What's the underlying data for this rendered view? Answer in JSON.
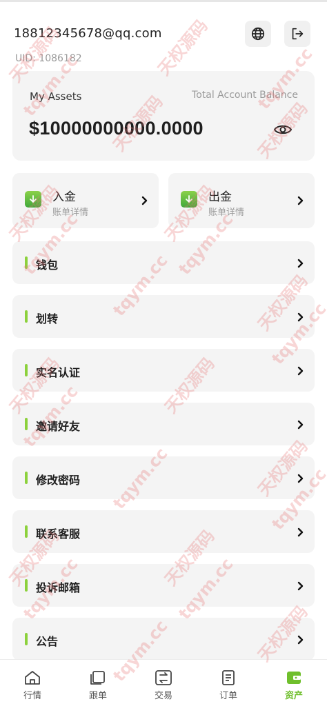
{
  "header": {
    "email": "18812345678@qq.com",
    "uid": "UID: 1086182"
  },
  "assets": {
    "title": "My Assets",
    "subtitle": "Total Account Balance",
    "amount": "$10000000000.0000"
  },
  "actions": {
    "deposit": {
      "title": "入金",
      "subtitle": "账单详情"
    },
    "withdraw": {
      "title": "出金",
      "subtitle": "账单详情"
    }
  },
  "menu": [
    {
      "label": "钱包"
    },
    {
      "label": "划转"
    },
    {
      "label": "实名认证"
    },
    {
      "label": "邀请好友"
    },
    {
      "label": "修改密码"
    },
    {
      "label": "联系客服"
    },
    {
      "label": "投诉邮箱"
    },
    {
      "label": "公告"
    }
  ],
  "tabs": [
    {
      "label": "行情",
      "icon": "home-icon"
    },
    {
      "label": "跟单",
      "icon": "copy-icon"
    },
    {
      "label": "交易",
      "icon": "swap-icon"
    },
    {
      "label": "订单",
      "icon": "orders-icon"
    },
    {
      "label": "资产",
      "icon": "wallet-icon",
      "active": true
    }
  ],
  "watermark": {
    "line1": "天权源码",
    "line2": "tqym.cc"
  },
  "colors": {
    "accent": "#8cd13c",
    "tab_active": "#6fbf2c",
    "card_bg": "#f4f4f4"
  }
}
